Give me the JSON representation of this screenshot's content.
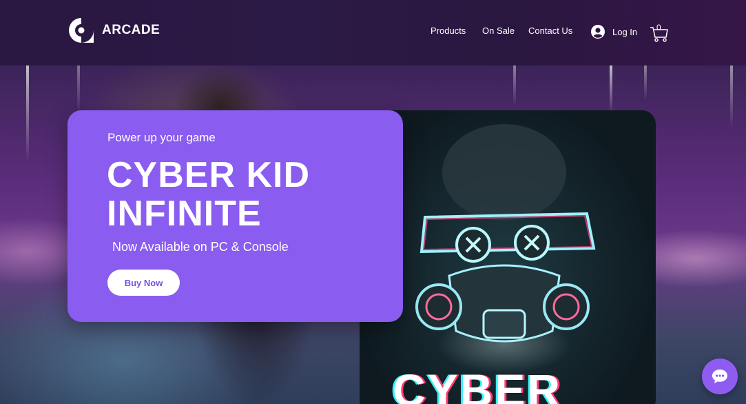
{
  "header": {
    "logo_text": "ARCADE",
    "nav": {
      "products": "Products",
      "on_sale": "On Sale",
      "contact": "Contact Us"
    },
    "login_label": "Log In",
    "cart_count": "0"
  },
  "hero": {
    "eyebrow": "Power up your game",
    "title_line1": "CYBER KID",
    "title_line2": "INFINITE",
    "subtitle": "Now Available on PC & Console",
    "cta_label": "Buy Now",
    "cover_title": "CYBER"
  },
  "colors": {
    "header_bg": "#2a1742",
    "card_purple": "#8a5cf0",
    "button_text": "#7a4fe0",
    "chat_purple": "#8f5cf2"
  },
  "icons": {
    "logo": "arcade-logo-icon",
    "user": "user-avatar-icon",
    "cart": "shopping-cart-icon",
    "chat": "chat-bubble-icon"
  }
}
